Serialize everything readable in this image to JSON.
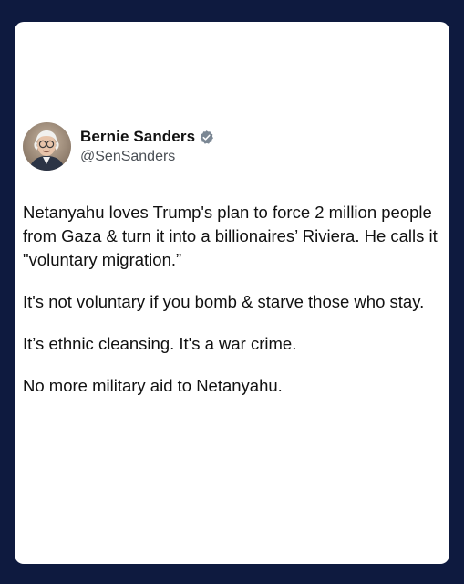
{
  "tweet": {
    "author": {
      "display_name": "Bernie Sanders",
      "handle": "@SenSanders",
      "verified": true
    },
    "paragraphs": [
      "Netanyahu loves Trump's plan to force 2 million people from Gaza & turn it into a billionaires’ Riviera. He calls it \"voluntary migration.”",
      "It's not voluntary if you bomb & starve those who stay.",
      "It’s ethnic cleansing. It's a war crime.",
      "No more military aid to Netanyahu."
    ]
  },
  "colors": {
    "frame_background": "#0e1a3f",
    "card_background": "#ffffff",
    "verified_badge": "#7b8794",
    "text": "#111111",
    "handle_text": "#4a4f55"
  },
  "icons": {
    "verified": "verified-badge-icon"
  }
}
